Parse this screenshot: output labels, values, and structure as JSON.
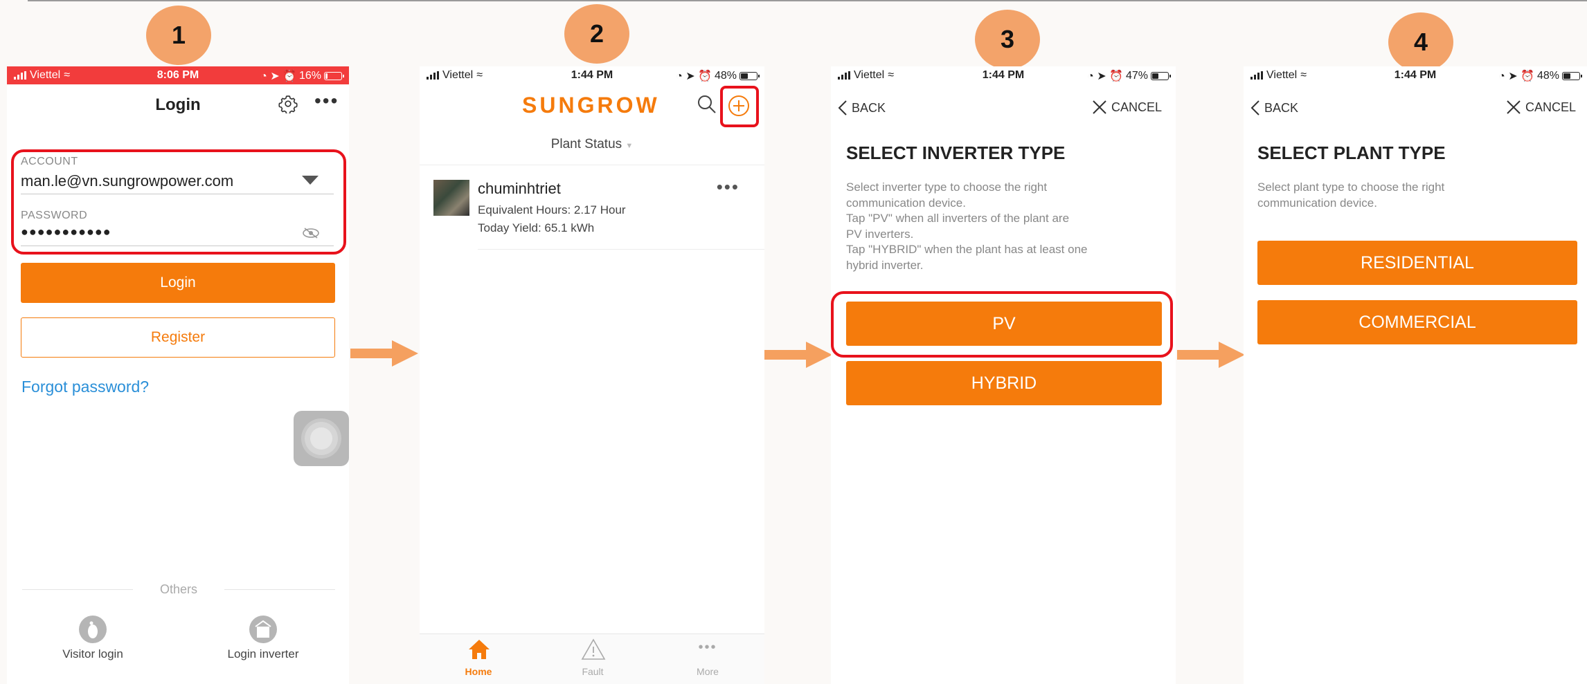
{
  "steps": [
    "1",
    "2",
    "3",
    "4"
  ],
  "colors": {
    "accent": "#f57b0c",
    "highlight": "#e8121c",
    "badge": "#f3a36a",
    "arrow": "#f5a05f",
    "link": "#2a8fd8"
  },
  "phone1": {
    "status": {
      "carrier": "Viettel",
      "time": "8:06 PM",
      "battery": "16%",
      "battery_level": 0.16
    },
    "title": "Login",
    "account_label": "ACCOUNT",
    "account_value": "man.le@vn.sungrowpower.com",
    "password_label": "PASSWORD",
    "password_value": "●●●●●●●●●●●",
    "login_button": "Login",
    "register_button": "Register",
    "forgot_link": "Forgot password?",
    "others_label": "Others",
    "visitor_login": "Visitor login",
    "login_inverter": "Login inverter",
    "icons": [
      "gear-icon",
      "more-icon",
      "chevron-down-icon",
      "eye-off-icon",
      "assistive-touch-icon",
      "visitor-icon",
      "inverter-icon"
    ]
  },
  "phone2": {
    "status": {
      "carrier": "Viettel",
      "time": "1:44 PM",
      "battery": "48%",
      "battery_level": 0.48
    },
    "logo": "SUNGROW",
    "plant_status": "Plant Status",
    "plant": {
      "name": "chuminhtriet",
      "equivalent_hours": "Equivalent Hours: 2.17 Hour",
      "today_yield": "Today Yield: 65.1 kWh"
    },
    "tabs": [
      {
        "label": "Home",
        "icon": "home-icon",
        "active": true
      },
      {
        "label": "Fault",
        "icon": "warning-icon",
        "active": false
      },
      {
        "label": "More",
        "icon": "more-icon",
        "active": false
      }
    ],
    "icons": [
      "search-icon",
      "add-circle-icon"
    ]
  },
  "phone3": {
    "status": {
      "carrier": "Viettel",
      "time": "1:44 PM",
      "battery": "47%",
      "battery_level": 0.47
    },
    "back": "BACK",
    "cancel": "CANCEL",
    "title": "SELECT INVERTER TYPE",
    "description": [
      "Select inverter type to choose the right",
      "communication device.",
      "Tap \"PV\" when all inverters of the plant are",
      "PV inverters.",
      "Tap \"HYBRID\" when the plant has at least one",
      "hybrid inverter."
    ],
    "options": [
      "PV",
      "HYBRID"
    ]
  },
  "phone4": {
    "status": {
      "carrier": "Viettel",
      "time": "1:44 PM",
      "battery": "48%",
      "battery_level": 0.48
    },
    "back": "BACK",
    "cancel": "CANCEL",
    "title": "SELECT PLANT TYPE",
    "description": [
      "Select plant type to choose the right",
      "communication device."
    ],
    "options": [
      "RESIDENTIAL",
      "COMMERCIAL"
    ]
  }
}
